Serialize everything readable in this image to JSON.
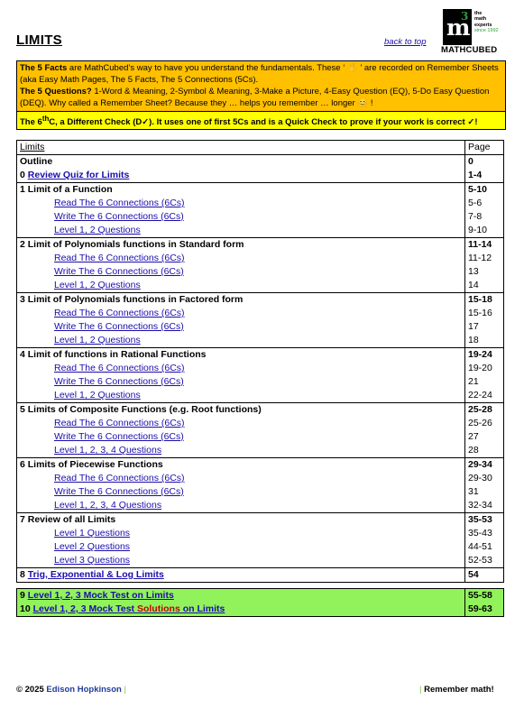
{
  "title": "LIMITS",
  "back_to_top": "back to top",
  "logo": {
    "letter": "m",
    "exponent": "3",
    "tagline": [
      "the",
      "math",
      "experts"
    ],
    "since": "since 1992",
    "brand": "MATHCUBED"
  },
  "info": {
    "p1_bold": "The 5 Facts",
    "p1_rest": " are MathCubed’s way to have you understand the fundamentals. These ‘ ✋ ’ are recorded on Remember Sheets (aka Easy Math Pages, The 5 Facts, The 5 Connections (5Cs).",
    "p2_bold": "The 5 Questions?",
    "p2_rest": " 1-Word & Meaning, 2-Symbol & Meaning, 3-Make a Picture, 4-Easy Question (EQ), 5-Do Easy Question (DEQ). Why called a Remember Sheet? Because they … helps you remember … longer 😊 !",
    "p3_a": "The 6",
    "p3_sup": "th",
    "p3_b": "C, a Different Check (D✓). It uses one of first 5Cs and is a Quick Check to prove if your work is correct ✓!"
  },
  "toc": {
    "header": {
      "label": "Limits",
      "page": "Page"
    },
    "outline": {
      "label": "Outline",
      "page": "0"
    },
    "review": {
      "num": "0 ",
      "link": "Review Quiz for Limits",
      "page": "1-4"
    },
    "sections": [
      {
        "title": "1 Limit of a Function",
        "page": "5-10",
        "items": [
          {
            "label": "Read The 6 Connections (6Cs)",
            "page": "5-6"
          },
          {
            "label": "Write The 6 Connections (6Cs)",
            "page": "7-8"
          },
          {
            "label": "Level 1, 2 Questions",
            "page": "9-10"
          }
        ]
      },
      {
        "title": "2 Limit of Polynomials functions in Standard form",
        "page": "11-14",
        "items": [
          {
            "label": "Read The 6 Connections (6Cs)",
            "page": "11-12"
          },
          {
            "label": "Write The 6 Connections (6Cs)",
            "page": "13"
          },
          {
            "label": "Level 1, 2 Questions",
            "page": "14"
          }
        ]
      },
      {
        "title": "3 Limit of Polynomials functions in Factored form",
        "page": "15-18",
        "items": [
          {
            "label": "Read The 6 Connections (6Cs)",
            "page": "15-16"
          },
          {
            "label": "Write The 6 Connections (6Cs)",
            "page": "17"
          },
          {
            "label": "Level 1, 2 Questions",
            "page": "18"
          }
        ]
      },
      {
        "title": "4 Limit of functions in Rational Functions",
        "page": "19-24",
        "items": [
          {
            "label": "Read The 6 Connections (6Cs)",
            "page": "19-20"
          },
          {
            "label": "Write The 6 Connections (6Cs)",
            "page": "21"
          },
          {
            "label": "Level 1, 2 Questions",
            "page": "22-24"
          }
        ]
      },
      {
        "title": "5 Limits of Composite Functions (e.g. Root functions)",
        "page": "25-28",
        "items": [
          {
            "label": "Read The 6 Connections (6Cs)",
            "page": "25-26"
          },
          {
            "label": "Write The 6 Connections (6Cs)",
            "page": "27"
          },
          {
            "label": "Level 1, 2, 3, 4 Questions",
            "page": "28"
          }
        ]
      },
      {
        "title": "6 Limits of Piecewise Functions",
        "page": "29-34",
        "items": [
          {
            "label": "Read The 6 Connections (6Cs)",
            "page": "29-30"
          },
          {
            "label": "Write The 6 Connections (6Cs)",
            "page": "31"
          },
          {
            "label": "Level 1, 2, 3, 4 Questions",
            "page": "32-34"
          }
        ]
      },
      {
        "title": "7 Review of all Limits",
        "page": "35-53",
        "items": [
          {
            "label": "Level 1 Questions",
            "page": "35-43"
          },
          {
            "label": "Level 2 Questions",
            "page": "44-51"
          },
          {
            "label": "Level 3 Questions",
            "page": "52-53"
          }
        ]
      }
    ],
    "trig": {
      "num": "8 ",
      "link": "Trig, Exponential & Log Limits",
      "page": "54"
    }
  },
  "mock": {
    "test": {
      "num": "9 ",
      "link": "Level 1, 2, 3 Mock Test on Limits",
      "page": "55-58"
    },
    "solutions": {
      "num": "10 ",
      "link_a": "Level 1, 2, 3 Mock Test ",
      "link_red": "Solutions",
      "link_b": " on Limits",
      "page": "59-63"
    }
  },
  "footer": {
    "copyright": "© 2025 ",
    "author": "Edison Hopkinson",
    "tagline": "Remember math!"
  },
  "colors": {
    "yellow_band": "#ffc000",
    "bright_yellow": "#ffff00",
    "mock_green": "#92f25c",
    "link": "#1a0dab",
    "accent_green": "#2e9d3a"
  }
}
